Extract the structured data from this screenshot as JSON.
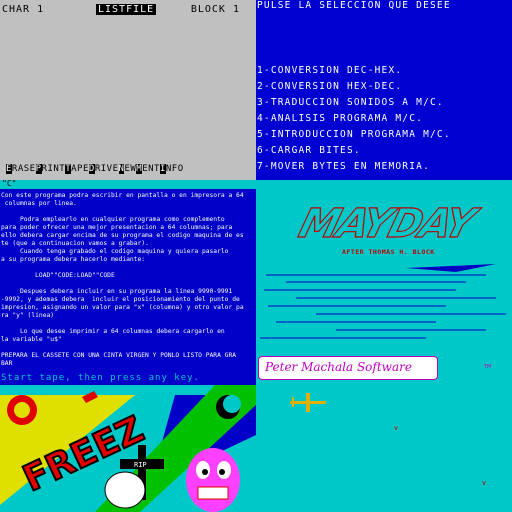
{
  "listfile": {
    "char_label": "CHAR 1",
    "title": "LISTFILE",
    "block_label": "BLOCK 1",
    "menu": [
      {
        "key": "E",
        "rest": "RASE"
      },
      {
        "key": "P",
        "rest": "RINT"
      },
      {
        "key": "T",
        "rest": "APE"
      },
      {
        "key": "D",
        "rest": "RIVE"
      },
      {
        "key": "N",
        "rest": "EW"
      },
      {
        "key": "M",
        "rest": "ENT"
      },
      {
        "key": "I",
        "rest": "NFO"
      }
    ]
  },
  "selection_menu": {
    "heading": "PULSE LA SELECCION QUE DESEE",
    "items": [
      "1-CONVERSION DEC-HEX.",
      "2-CONVERSION HEX-DEC.",
      "3-TRADUCCION SONIDOS A M/C.",
      "4-ANALISIS PROGRAMA M/C.",
      "5-INTRODUCCION PROGRAMA M/C.",
      "6-CARGAR BITES.",
      "7-MOVER BYTES EN MEMORIA."
    ]
  },
  "text64": {
    "strip_text": "\"C\"",
    "body": "Con este programa podra escribir en pantalla o en impresora a 64\n columnas por linea.\n\n     Podra emplearlo en cualquier programa como complemento\npara poder ofrecer una mejor presentacion a 64 columnas; para\nello debera cargar encima de su programa el codigo maquina de es\nte (que a continuacion vamos a grabar).\n     Cuando tenga grabado el codigo maquina y quiera pasarlo\na su programa debera hacerlo mediante:\n\n         LOAD\"\"CODE:LOAD\"\"CODE\n\n     Despues debera incluir en su programa la linea 9990-9991\n-9992, y ademas debera  incluir el posicionamiento del punto de\nimpresion, asignando un valor para \"x\" (columna) y otro valor pa\nra \"y\" (linea)\n\n     Lo que desee imprimir a 64 columnas debera cargarlo en\nla variable \"u$\"\n\nPREPARA EL CASSETE CON UNA CINTA VIRGEN Y PONLO LISTO PARA GRA\nBAR",
    "tape_prompt": "Start tape, then press any key."
  },
  "mayday": {
    "logo": "MAYDAY",
    "byline": "AFTER  THOMAS  H. BLOCK",
    "credit": "Peter Machala Software",
    "trademark": "TM"
  },
  "freez": {
    "logo": "FREEZ",
    "rip": "RIP"
  },
  "colors": {
    "grey": "#c0c0c0",
    "blue": "#0000d0",
    "cyan": "#00c8c8",
    "red": "#e00000",
    "magenta": "#c000c0",
    "yellow": "#e0e000",
    "green": "#00c000"
  }
}
